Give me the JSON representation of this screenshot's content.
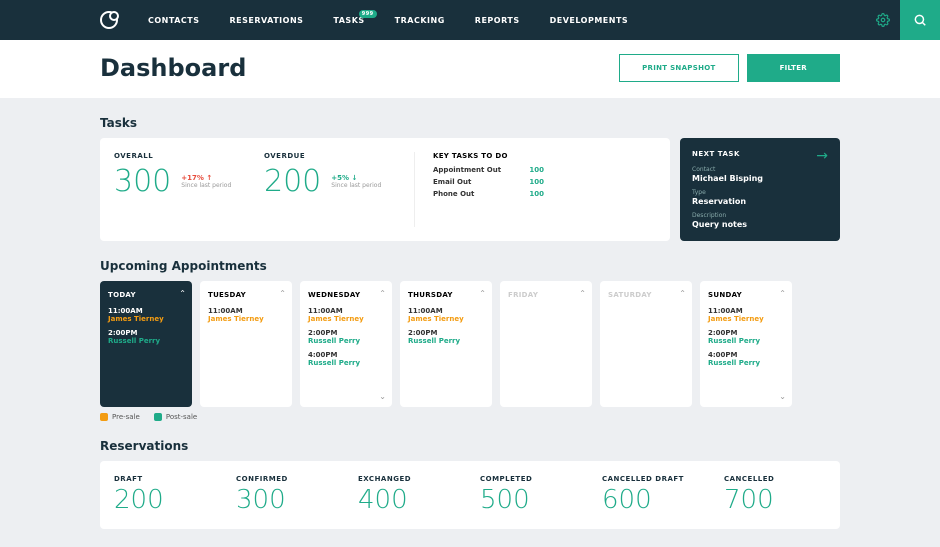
{
  "nav": {
    "items": [
      "CONTACTS",
      "RESERVATIONS",
      "TASKS",
      "TRACKING",
      "REPORTS",
      "DEVELOPMENTS"
    ],
    "badge": "999"
  },
  "header": {
    "title": "Dashboard",
    "snapshot": "PRINT SNAPSHOT",
    "filter": "FILTER"
  },
  "tasks": {
    "title": "Tasks",
    "overall": {
      "label": "OVERALL",
      "value": "300",
      "delta": "+17% ↑",
      "sub": "Since last period"
    },
    "overdue": {
      "label": "OVERDUE",
      "value": "200",
      "delta": "+5% ↓",
      "sub": "Since last period"
    },
    "key": {
      "title": "KEY TASKS TO DO",
      "rows": [
        {
          "name": "Appointment Out",
          "val": "100"
        },
        {
          "name": "Email Out",
          "val": "100"
        },
        {
          "name": "Phone Out",
          "val": "100"
        }
      ]
    },
    "next": {
      "title": "NEXT TASK",
      "contact_l": "Contact",
      "contact": "Michael Bisping",
      "type_l": "Type",
      "type": "Reservation",
      "desc_l": "Description",
      "desc": "Query notes"
    }
  },
  "upcoming": {
    "title": "Upcoming Appointments",
    "days": [
      {
        "name": "TODAY",
        "today": true,
        "appts": [
          {
            "t": "11:00AM",
            "n": "James Tierney",
            "k": "pre"
          },
          {
            "t": "2:00PM",
            "n": "Russell Perry",
            "k": "post"
          }
        ]
      },
      {
        "name": "TUESDAY",
        "appts": [
          {
            "t": "11:00AM",
            "n": "James Tierney",
            "k": "pre"
          }
        ]
      },
      {
        "name": "WEDNESDAY",
        "more": true,
        "appts": [
          {
            "t": "11:00AM",
            "n": "James Tierney",
            "k": "pre"
          },
          {
            "t": "2:00PM",
            "n": "Russell Perry",
            "k": "post"
          },
          {
            "t": "4:00PM",
            "n": "Russell Perry",
            "k": "post"
          }
        ]
      },
      {
        "name": "THURSDAY",
        "appts": [
          {
            "t": "11:00AM",
            "n": "James Tierney",
            "k": "pre"
          },
          {
            "t": "2:00PM",
            "n": "Russell Perry",
            "k": "post"
          }
        ]
      },
      {
        "name": "FRIDAY",
        "empty": true,
        "appts": []
      },
      {
        "name": "SATURDAY",
        "empty": true,
        "appts": []
      },
      {
        "name": "SUNDAY",
        "more": true,
        "appts": [
          {
            "t": "11:00AM",
            "n": "James Tierney",
            "k": "pre"
          },
          {
            "t": "2:00PM",
            "n": "Russell Perry",
            "k": "post"
          },
          {
            "t": "4:00PM",
            "n": "Russell Perry",
            "k": "post"
          }
        ]
      }
    ],
    "legend": {
      "pre": "Pre-sale",
      "post": "Post-sale"
    }
  },
  "reservations": {
    "title": "Reservations",
    "cols": [
      {
        "label": "DRAFT",
        "val": "200"
      },
      {
        "label": "CONFIRMED",
        "val": "300"
      },
      {
        "label": "EXCHANGED",
        "val": "400"
      },
      {
        "label": "COMPLETED",
        "val": "500"
      },
      {
        "label": "CANCELLED DRAFT",
        "val": "600"
      },
      {
        "label": "CANCELLED",
        "val": "700"
      }
    ]
  }
}
